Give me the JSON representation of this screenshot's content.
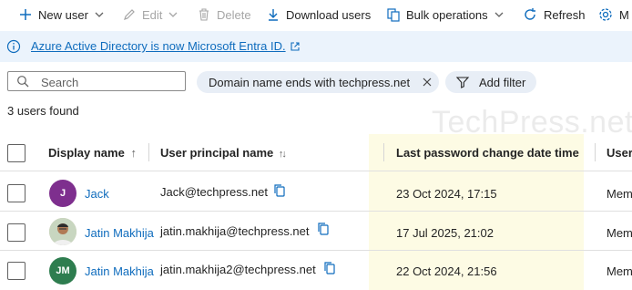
{
  "toolbar": {
    "new_user": "New user",
    "edit": "Edit",
    "delete": "Delete",
    "download_users": "Download users",
    "bulk_operations": "Bulk operations",
    "refresh": "Refresh",
    "manage_truncated": "M"
  },
  "banner": {
    "text": "Azure Active Directory is now Microsoft Entra ID."
  },
  "search": {
    "placeholder": "Search"
  },
  "filters": {
    "active_filter": "Domain name ends with techpress.net",
    "add_filter": "Add filter"
  },
  "result_count": "3 users found",
  "watermark": "TechPress.net",
  "table": {
    "columns": {
      "display_name": "Display name",
      "display_name_sort": "↑",
      "upn": "User principal name",
      "upn_sort": "↑↓",
      "last_pwd": "Last password change date time",
      "user_type_truncated": "User"
    },
    "rows": [
      {
        "avatar_initials": "J",
        "avatar_color": "#7e2f8e",
        "display_name": "Jack",
        "upn": "Jack@techpress.net",
        "last_pwd": "23 Oct 2024, 17:15",
        "user_type": "Mem"
      },
      {
        "avatar_initials": "",
        "avatar_color": "photo",
        "display_name": "Jatin Makhija",
        "upn": "jatin.makhija@techpress.net",
        "last_pwd": "17 Jul 2025, 21:02",
        "user_type": "Mem"
      },
      {
        "avatar_initials": "JM",
        "avatar_color": "#2e7d4f",
        "display_name": "Jatin Makhija",
        "upn": "jatin.makhija2@techpress.net",
        "last_pwd": "22 Oct 2024, 21:56",
        "user_type": "Mem"
      }
    ]
  },
  "icons": {
    "info": "info-icon",
    "external_link": "external-link-icon",
    "copy": "copy-icon",
    "filter": "filter-icon",
    "search": "search-icon",
    "close": "close-icon"
  },
  "colors": {
    "accent": "#0f6cbd",
    "banner_bg": "#ebf3fc",
    "highlight_column": "#fdfbe4",
    "pill_bg": "#e8eef6"
  }
}
